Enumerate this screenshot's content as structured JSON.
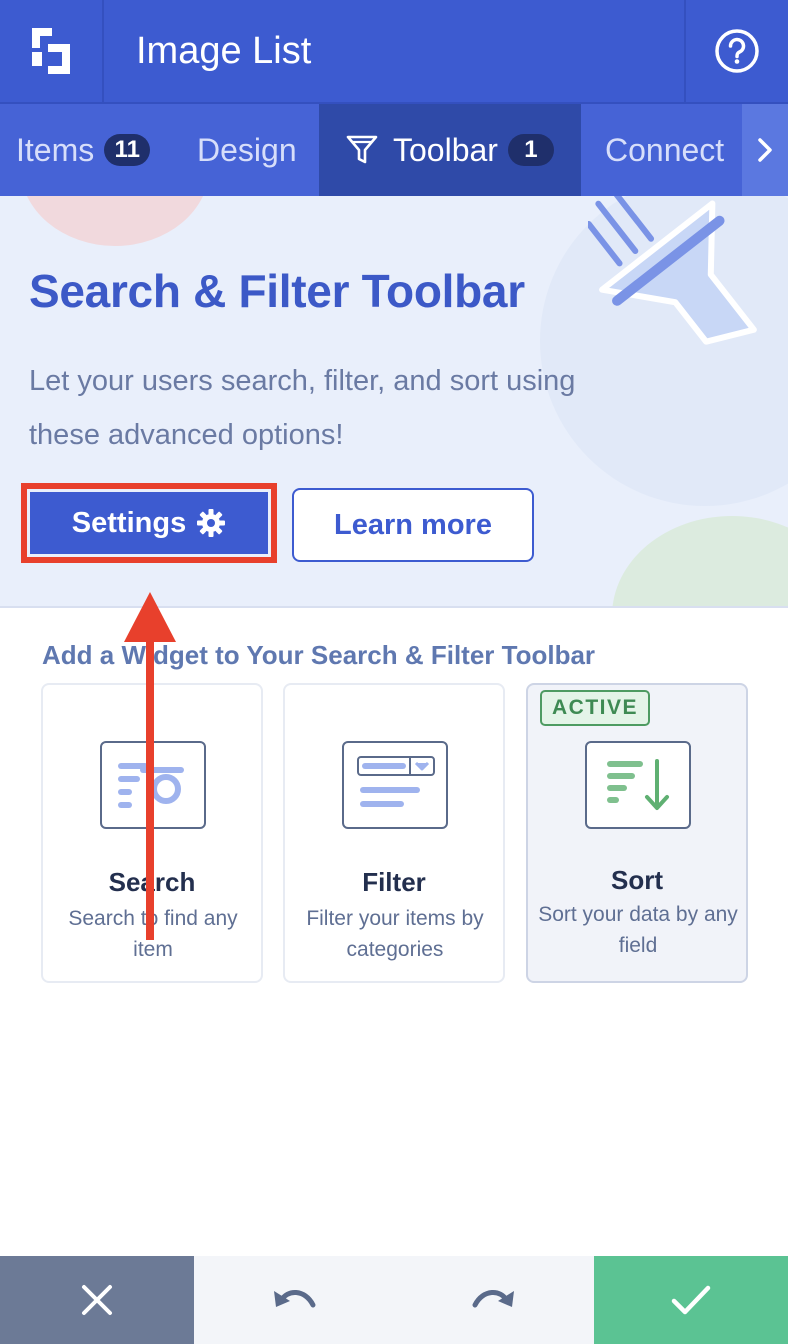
{
  "header": {
    "logo_icon": "app-logo-icon",
    "title": "Image List",
    "help_icon": "help-circle-icon"
  },
  "tabs": [
    {
      "label": "Items",
      "count": "11"
    },
    {
      "label": "Design"
    },
    {
      "label": "Toolbar",
      "count": "1",
      "icon": "funnel-icon",
      "active": true
    },
    {
      "label": "Connect"
    }
  ],
  "hero": {
    "title": "Search & Filter Toolbar",
    "description": "Let your users search, filter, and sort using these advanced options!",
    "settings_label": "Settings",
    "learn_more_label": "Learn more"
  },
  "widgets": {
    "section_title": "Add a Widget to Your Search & Filter Toolbar",
    "items": [
      {
        "name": "Search",
        "description": "Search to find any item",
        "icon": "search-widget-icon"
      },
      {
        "name": "Filter",
        "description": "Filter your items by categories",
        "icon": "filter-widget-icon"
      },
      {
        "name": "Sort",
        "description": "Sort your data by any field",
        "icon": "sort-widget-icon",
        "badge": "ACTIVE"
      }
    ]
  },
  "bottombar": {
    "close_icon": "close-icon",
    "undo_icon": "undo-icon",
    "redo_icon": "redo-icon",
    "confirm_icon": "check-icon"
  },
  "colors": {
    "primary": "#3d5bd0",
    "tab_active": "#2f4aa8",
    "highlight": "#e8402c",
    "confirm": "#5bc393",
    "active_badge": "#4e9b62"
  }
}
